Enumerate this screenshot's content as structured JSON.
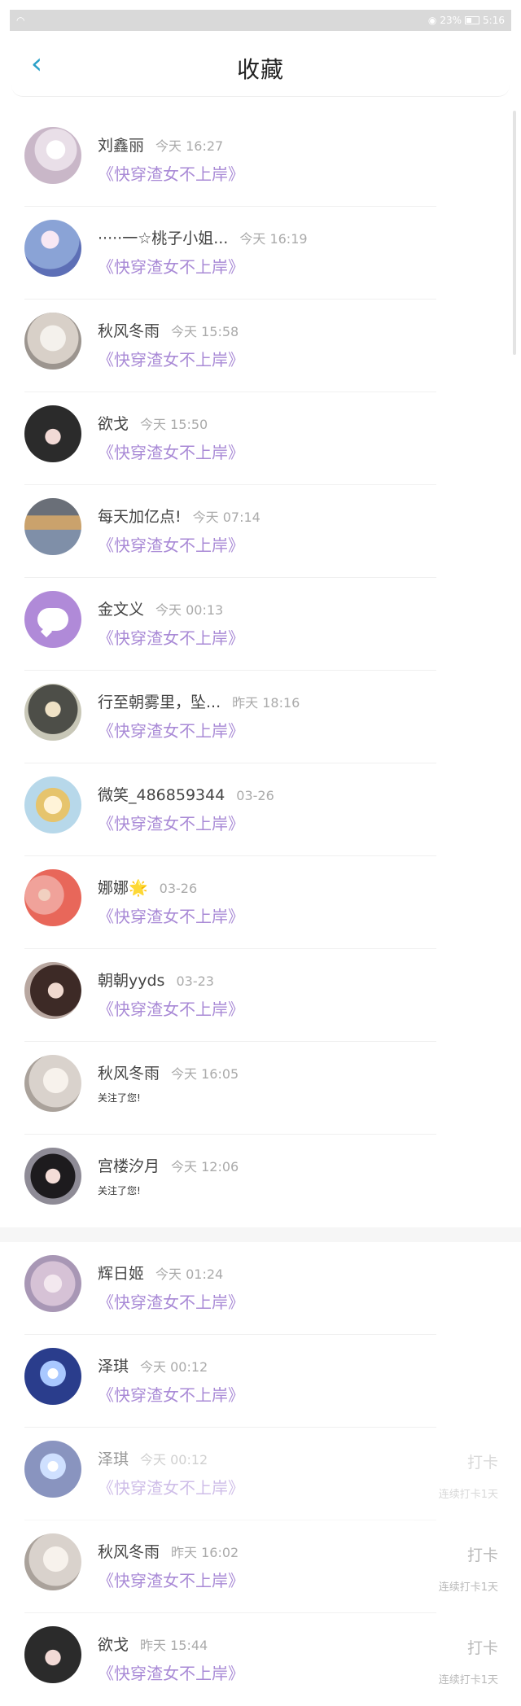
{
  "status": {
    "eye": "◉",
    "battery": "23%",
    "time": "5:16"
  },
  "header": {
    "title": "收藏",
    "back_icon": "‹"
  },
  "items": [
    {
      "name": "刘鑫丽",
      "time": "今天 16:27",
      "book": "《快穿渣女不上岸》"
    },
    {
      "name": "·····一☆桃子小姐...",
      "time": "今天 16:19",
      "book": "《快穿渣女不上岸》"
    },
    {
      "name": "秋风冬雨",
      "time": "今天 15:58",
      "book": "《快穿渣女不上岸》"
    },
    {
      "name": "欲戈",
      "time": "今天 15:50",
      "book": "《快穿渣女不上岸》"
    },
    {
      "name": "每天加亿点!",
      "time": "今天 07:14",
      "book": "《快穿渣女不上岸》"
    },
    {
      "name": "金文义",
      "time": "今天 00:13",
      "book": "《快穿渣女不上岸》"
    },
    {
      "name": "行至朝雾里，坠...",
      "time": "昨天 18:16",
      "book": "《快穿渣女不上岸》"
    },
    {
      "name": "微笑_486859344",
      "time": "03-26",
      "book": "《快穿渣女不上岸》"
    },
    {
      "name": "娜娜🌟",
      "time": "03-26",
      "book": "《快穿渣女不上岸》"
    },
    {
      "name": "朝朝yyds",
      "time": "03-23",
      "book": "《快穿渣女不上岸》"
    },
    {
      "name": "秋风冬雨",
      "time": "今天 16:05",
      "note": "关注了您!"
    },
    {
      "name": "宫楼汐月",
      "time": "今天 12:06",
      "note": "关注了您!"
    }
  ],
  "items2": [
    {
      "name": "辉日姬",
      "time": "今天 01:24",
      "book": "《快穿渣女不上岸》"
    },
    {
      "name": "泽琪",
      "time": "今天 00:12",
      "book": "《快穿渣女不上岸》"
    },
    {
      "name": "泽琪",
      "time": "今天 00:12",
      "book": "《快穿渣女不上岸》",
      "checkin": "打卡",
      "streak": "连续打卡1天"
    },
    {
      "name": "秋风冬雨",
      "time": "昨天 16:02",
      "book": "《快穿渣女不上岸》",
      "checkin": "打卡",
      "streak": "连续打卡1天"
    },
    {
      "name": "欲戈",
      "time": "昨天 15:44",
      "book": "《快穿渣女不上岸》",
      "checkin": "打卡",
      "streak": "连续打卡1天"
    }
  ],
  "colors": {
    "accent": "#2aa0c8",
    "book": "#a98ad6",
    "meta": "#aaaaaa"
  },
  "icons": {
    "back": "chevron-left-icon",
    "eye": "eye-icon",
    "battery": "battery-icon",
    "wifi": "wifi-icon"
  }
}
